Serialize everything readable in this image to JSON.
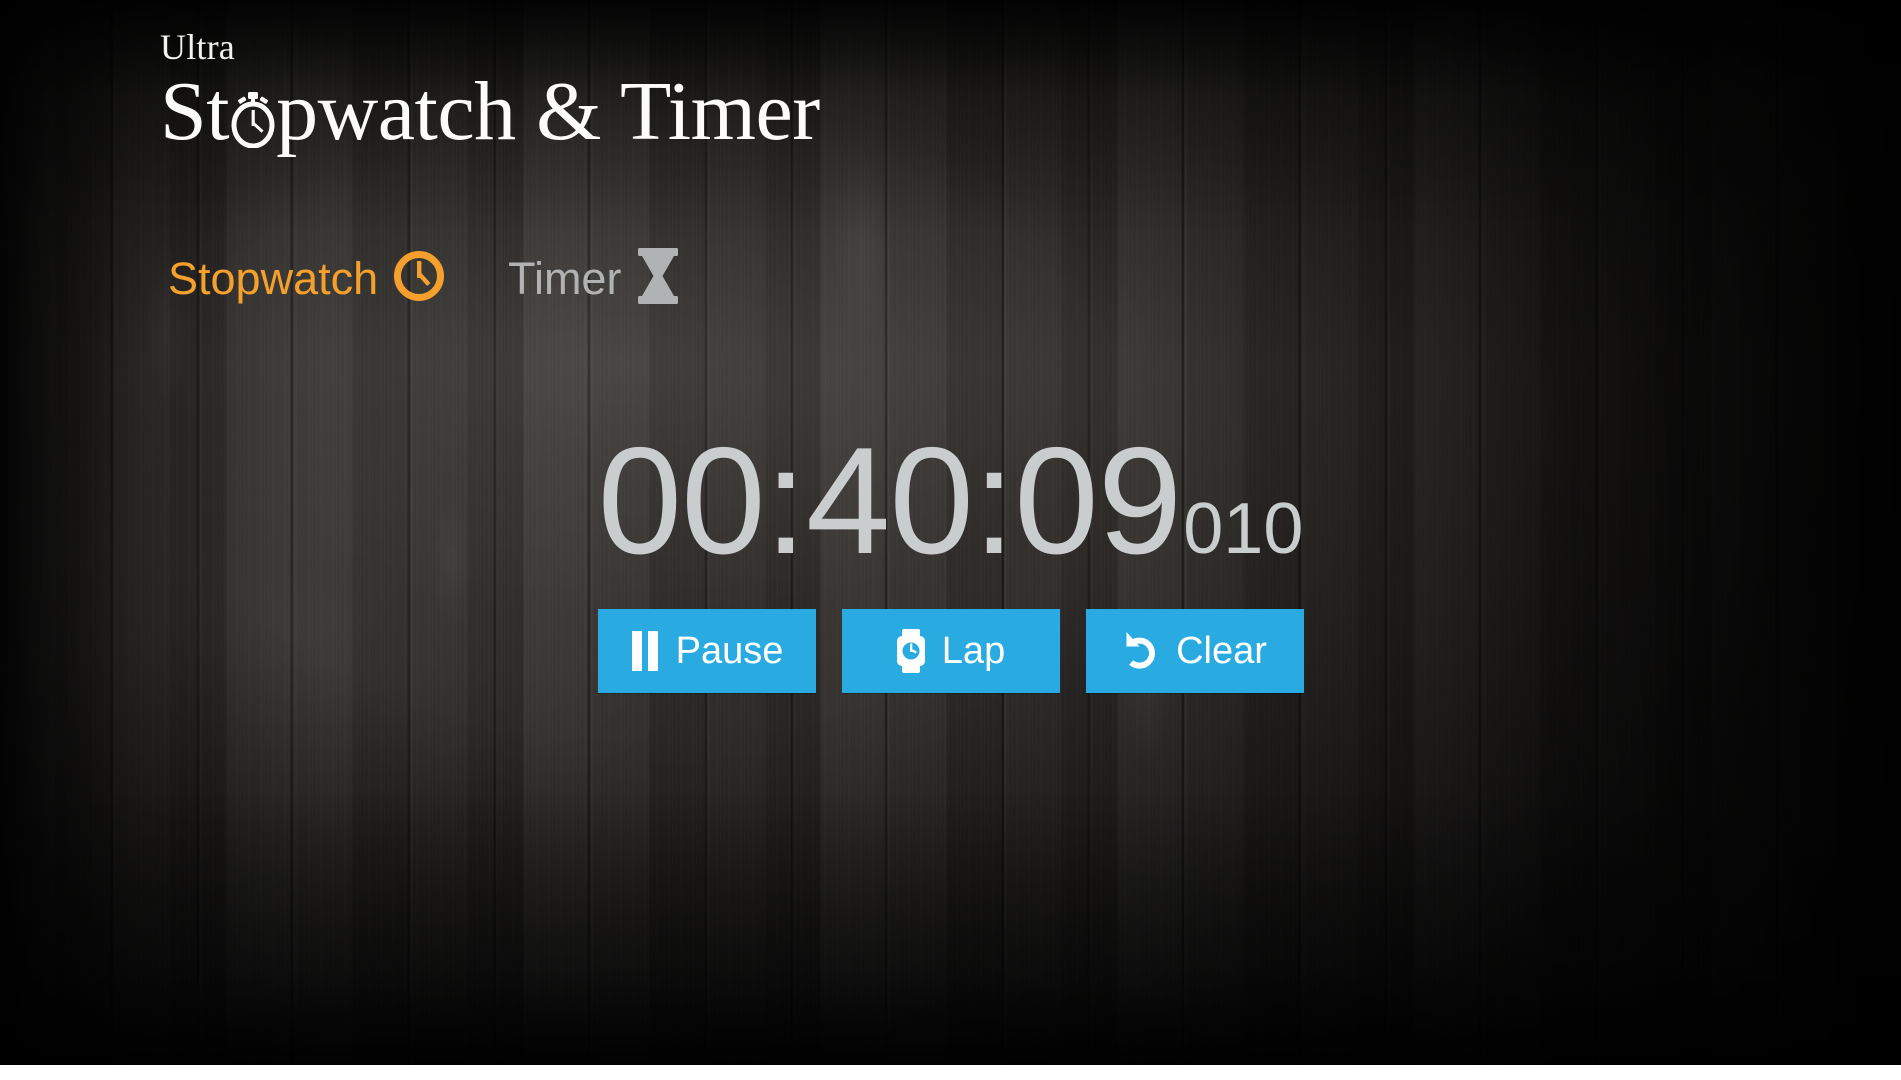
{
  "app": {
    "brand_small": "Ultra",
    "brand_title_before": "St",
    "brand_title_after": "pwatch & Timer",
    "brand_icon": "stopwatch-icon"
  },
  "colors": {
    "accent_orange": "#f5a02d",
    "accent_blue": "#29abe2",
    "inactive_gray": "#b0b2b3",
    "timer_gray": "#c9cdcd",
    "background_wood": "#2a2826"
  },
  "tabs": [
    {
      "label": "Stopwatch",
      "icon": "clock-icon",
      "active": true
    },
    {
      "label": "Timer",
      "icon": "hourglass-icon",
      "active": false
    }
  ],
  "timer": {
    "main": "00:40:09",
    "milliseconds": "010",
    "hours": "00",
    "minutes": "40",
    "seconds": "09"
  },
  "buttons": [
    {
      "label": "Pause",
      "icon": "pause-icon"
    },
    {
      "label": "Lap",
      "icon": "watch-icon"
    },
    {
      "label": "Clear",
      "icon": "undo-icon"
    }
  ]
}
